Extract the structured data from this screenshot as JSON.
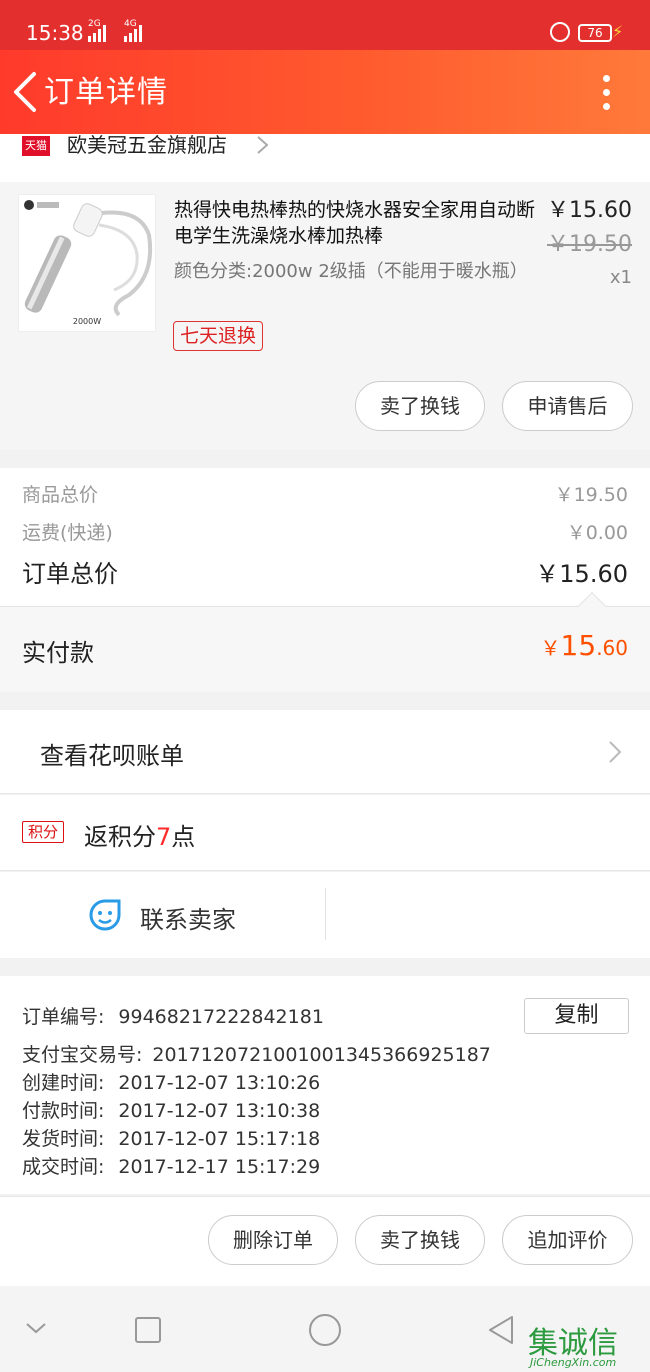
{
  "status_bar": {
    "time": "15:38",
    "net1": "2G",
    "net2": "4G",
    "battery": "76"
  },
  "header": {
    "title": "订单详情"
  },
  "shop": {
    "badge": "天猫",
    "name": "欧美冠五金旗舰店"
  },
  "item": {
    "name": "热得快电热棒热的快烧水器安全家用自动断电学生洗澡烧水棒加热棒",
    "spec": "颜色分类:2000w 2级插（不能用于暖水瓶）",
    "tag": "七天退换",
    "price": "￥15.60",
    "original_price": "￥19.50",
    "qty": "x1",
    "thumb_caption": "2000W",
    "buttons": {
      "sell": "卖了换钱",
      "after_sale": "申请售后"
    }
  },
  "price_summary": {
    "goods_label": "商品总价",
    "goods_value": "￥19.50",
    "shipping_label": "运费(快递)",
    "shipping_value": "￥0.00",
    "total_label": "订单总价",
    "total_value": "￥15.60",
    "paid_label": "实付款",
    "paid_currency": "￥",
    "paid_int": "15",
    "paid_dec": ".60"
  },
  "huabei": {
    "label": "查看花呗账单"
  },
  "points": {
    "badge": "积分",
    "prefix": "返积分",
    "num": "7",
    "suffix": "点"
  },
  "contact": {
    "label": "联系卖家"
  },
  "order_info": {
    "order_no_label": "订单编号:",
    "order_no": "99468217222842181",
    "copy_label": "复制",
    "alipay_label": "支付宝交易号:",
    "alipay_no": "2017120721001001345366925187",
    "created_label": "创建时间:",
    "created": "2017-12-07 13:10:26",
    "paid_label": "付款时间:",
    "paid": "2017-12-07 13:10:38",
    "shipped_label": "发货时间:",
    "shipped": "2017-12-07 15:17:18",
    "done_label": "成交时间:",
    "done": "2017-12-17 15:17:29"
  },
  "actions": {
    "delete": "删除订单",
    "sell": "卖了换钱",
    "review": "追加评价"
  },
  "watermark": {
    "text": "集诚信",
    "url": "JiChengXin.com"
  },
  "colors": {
    "header": "#ff4a2c",
    "price_accent": "#ff5000",
    "points_red": "#ff2a2a"
  }
}
